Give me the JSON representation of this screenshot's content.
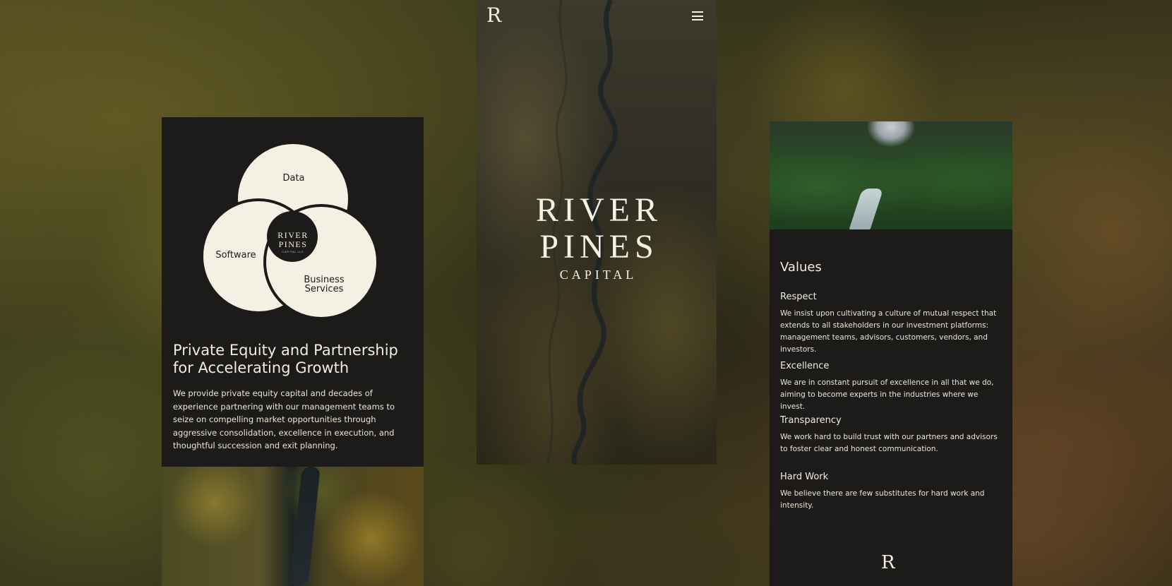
{
  "left_card": {
    "venn": {
      "top_label": "Data",
      "left_label": "Software",
      "right_label_line1": "Business",
      "right_label_line2": "Services",
      "center_line1": "RIVER",
      "center_line2": "PINES",
      "center_line3": "CAPITAL LLC"
    },
    "title": "Private Equity and Partnership for Accelerating Growth",
    "body": "We provide private equity capital and decades of experience partnering with our management teams to seize on compelling market opportunities through aggressive consolidation, excellence in execution, and thoughtful succession and exit planning."
  },
  "center_card": {
    "logo": "R",
    "brand_line1": "RIVER",
    "brand_line2": "PINES",
    "brand_line3": "CAPITAL"
  },
  "right_card": {
    "title": "Values",
    "values": [
      {
        "heading": "Respect",
        "text": "We insist upon cultivating a culture of mutual respect that extends to all stakeholders in our investment platforms: management teams, advisors, customers, vendors, and investors."
      },
      {
        "heading": "Excellence",
        "text": "We are in constant pursuit of excellence in all that we do, aiming to become experts in the industries where we invest."
      },
      {
        "heading": "Transparency",
        "text": "We work hard to build trust with our partners and advisors to foster clear and honest communication."
      },
      {
        "heading": "Hard Work",
        "text": "We believe there are few substitutes for hard work and intensity."
      }
    ],
    "footer_logo": "R"
  },
  "colors": {
    "card_background": "#1c1b19",
    "cream": "#f4efe3"
  },
  "icons": {
    "menu": "hamburger-menu-icon"
  }
}
